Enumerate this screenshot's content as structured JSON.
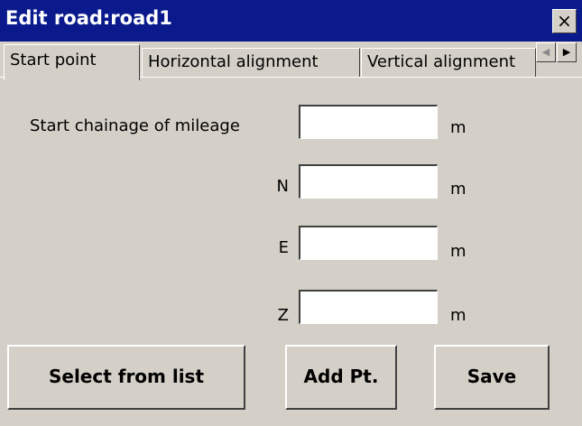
{
  "window": {
    "title": "Edit road:road1",
    "close_glyph": "×"
  },
  "tabs": [
    {
      "label": "Start point",
      "active": true
    },
    {
      "label": "Horizontal alignment",
      "active": false
    },
    {
      "label": "Vertical alignment",
      "active": false
    }
  ],
  "tab_scroll": {
    "left_glyph": "◀",
    "right_glyph": "▶",
    "left_icon": "arrow-left-icon",
    "right_icon": "arrow-right-icon"
  },
  "form": {
    "start_chainage_label": "Start chainage of mileage",
    "start_chainage_value": "",
    "start_chainage_unit": "m",
    "n_label": "N",
    "n_value": "",
    "n_unit": "m",
    "e_label": "E",
    "e_value": "",
    "e_unit": "m",
    "z_label": "Z",
    "z_value": "",
    "z_unit": "m"
  },
  "buttons": {
    "select_from_list": "Select from list",
    "add_pt": "Add Pt.",
    "save": "Save"
  },
  "colors": {
    "titlebar": "#0a1a8c",
    "face": "#d4d0c8"
  }
}
